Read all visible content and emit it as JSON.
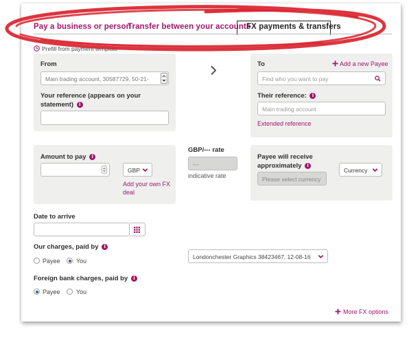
{
  "tabs": {
    "pay_business": "Pay a business or person",
    "transfer": "Transfer between your accounts",
    "fx": "FX payments & transfers"
  },
  "prefill_label": "Prefill from payment template",
  "from": {
    "label": "From",
    "value": "Main trading account, 30587729, 50-21-"
  },
  "your_reference": {
    "label_line1": "Your reference (appears on your",
    "label_line2": "statement)",
    "value": ""
  },
  "to": {
    "label": "To",
    "add_payee": "Add a new Payee",
    "search_placeholder": "Find who you want to pay",
    "their_reference_label": "Their reference:",
    "their_reference_placeholder": "Main trading account",
    "extended_reference": "Extended reference"
  },
  "amount": {
    "label": "Amount to pay",
    "value": "",
    "currency": "GBP",
    "fx_deal_line1": "Add your own FX",
    "fx_deal_line2": "deal"
  },
  "rate": {
    "label": "GBP/--- rate",
    "value": "---",
    "note": "indicative rate"
  },
  "payee_receive": {
    "label_line1": "Payee will receive",
    "label_line2": "approximately",
    "placeholder": "Please select currency",
    "currency": "Currency"
  },
  "date": {
    "label": "Date to arrive",
    "value": ""
  },
  "our_charges": {
    "label": "Our charges, paid by",
    "options": [
      "Payee",
      "You"
    ],
    "selected": "You"
  },
  "charges_account": "Londonchester Graphics 38423467, 12-08-16",
  "foreign_charges": {
    "label": "Foreign bank charges, paid by",
    "options": [
      "Payee",
      "You"
    ],
    "selected": "Payee"
  },
  "more_options": "More FX options",
  "colors": {
    "accent": "#a2156b",
    "panel": "#eff0ee",
    "annotation": "#d9242f"
  },
  "icons": [
    "clock-icon",
    "chevron-down-icon",
    "chevron-right-icon",
    "search-icon",
    "plus-icon",
    "info-icon",
    "calendar-icon",
    "spinner-icon"
  ]
}
